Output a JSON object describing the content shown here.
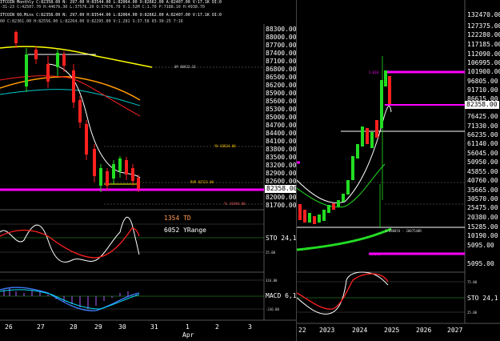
{
  "left_chart": {
    "header_line1": "ITCOIN Monthly C:82358.00 N: 297.00 H:83544.00 L:82064.00 O:82662.00 A:82407.00 V:17.1K OI:0",
    "header_line2": "-31-23 C:42507.70 H:44676.30 L:37576.20 O:37676.70 V:1.52M C:1.70 P:7188.10 H:4938.70",
    "header_line3": "ITCOIN 60.Mins C:82358.00 N: 297.00 H:83544.00 L:82064.00 O:82662.00 A:82407.00 V:17.1K OI:0",
    "header_line4": "00 C:82361.00 H:82556.00 L:82264.00 O:82295.00 V:1.281 S:37.58 03-30-25 7:16",
    "price_axis": [
      "88300.00",
      "88000.00",
      "87700.00",
      "87400.00",
      "87100.00",
      "86800.00",
      "86500.00",
      "86200.00",
      "85900.00",
      "85600.00",
      "85300.00",
      "85000.00",
      "84700.00",
      "84400.00",
      "84100.00",
      "83800.00",
      "83500.00",
      "83200.00",
      "82900.00",
      "82600.00",
      "82300.00",
      "82000.00",
      "81700.00"
    ],
    "current_price": "82358.00",
    "annotations": {
      "op": "OP 86923.16",
      "yh": "YH 83834.00",
      "rvr": "RVR 82523.00",
      "yl": "YL 81994.00"
    },
    "td_label": "1354 TD",
    "yrange_label": "6052 YRange",
    "sto_label": "STO 24,1",
    "macd_label": "MACD 6,1",
    "osc_levels": {
      "upper": "75.00",
      "lower": "25.00"
    },
    "macd_levels": {
      "upper": "316.00",
      "zero": "0.00",
      "lower": "-316.00"
    },
    "time_axis": [
      "26",
      "27",
      "28",
      "29",
      "30",
      "31",
      "1",
      "2",
      "3"
    ],
    "time_axis_month": "Apr"
  },
  "right_chart": {
    "price_axis": [
      "132470.00",
      "127375.00",
      "122280.00",
      "117185.00",
      "112090.00",
      "106995.00",
      "101900.00",
      "96805.00",
      "91710.00",
      "86615.00",
      "81520.00",
      "76425.00",
      "71330.00",
      "66235.00",
      "61140.00",
      "56045.00",
      "50950.00",
      "45855.00",
      "40760.00",
      "35665.00",
      "30570.00",
      "25475.00",
      "20380.00",
      "15285.00",
      "10190.00",
      "5095.00"
    ],
    "current_price": "82358.00",
    "lower_label": "5095.00",
    "annotation_bar": "1.680054 - 2007540R",
    "annotation_low": "1.272",
    "sto_label": "STO 24,1",
    "osc_levels": {
      "upper": "75.00",
      "lower": "25.00"
    },
    "time_axis": [
      "22",
      "2023",
      "2024",
      "2025",
      "2026",
      "2027"
    ]
  },
  "colors": {
    "magenta": "#ff00ff",
    "green_line": "#22dd22",
    "red_line": "#ff2020",
    "orange": "#ff9900",
    "yellow": "#ffff00",
    "teal": "#00c8c8",
    "purple": "#b060ff"
  }
}
